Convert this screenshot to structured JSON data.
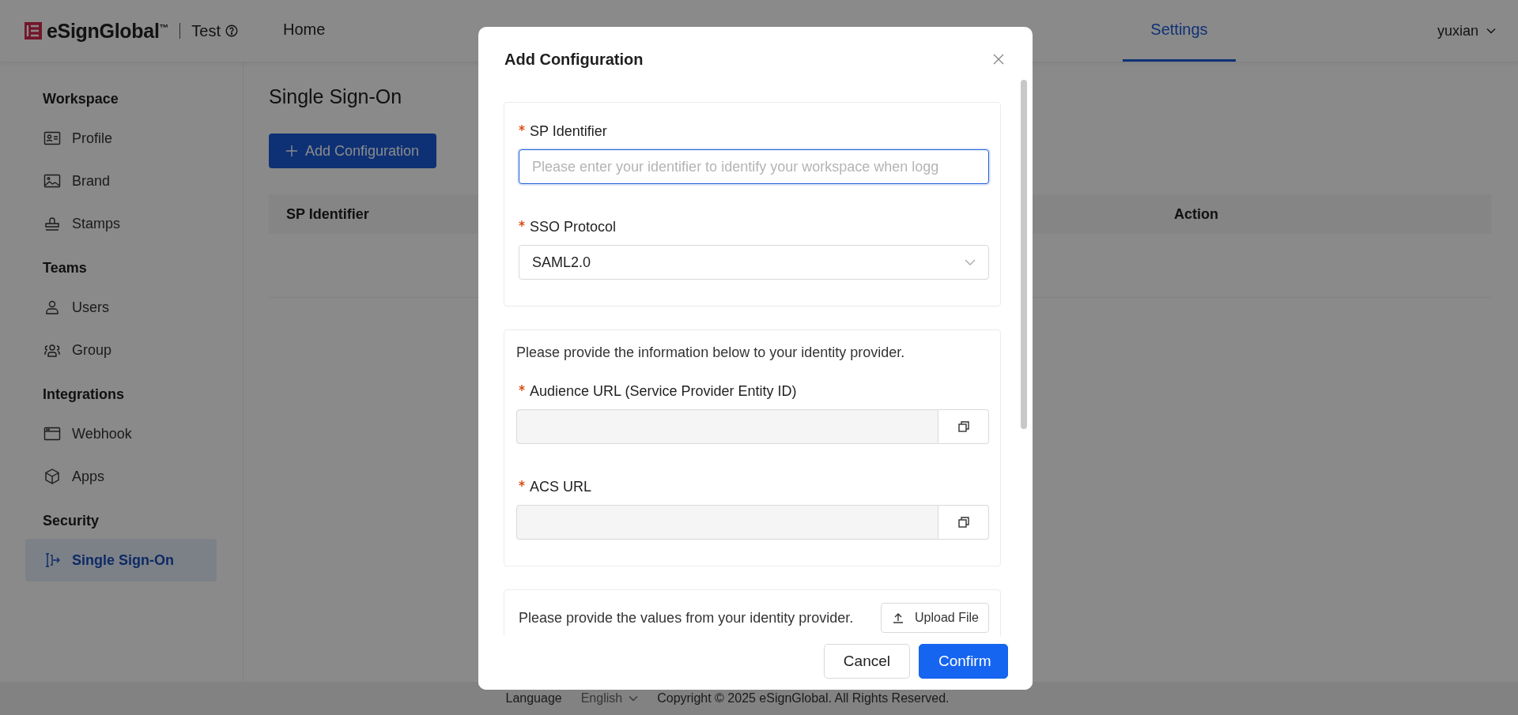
{
  "header": {
    "brand": "eSignGlobal$^{™}$",
    "workspace": "Test",
    "nav": [
      {
        "label": "Home",
        "selected": false
      },
      {
        "label": "Settings",
        "selected": true
      }
    ],
    "user": "yuxian"
  },
  "sidebar": {
    "sections": [
      {
        "title": "Workspace",
        "items": [
          {
            "label": "Profile",
            "selected": false
          },
          {
            "label": "Brand",
            "selected": false
          },
          {
            "label": "Stamps",
            "selected": false
          }
        ]
      },
      {
        "title": "Teams",
        "items": [
          {
            "label": "Users",
            "selected": false
          },
          {
            "label": "Group",
            "selected": false
          }
        ]
      },
      {
        "title": "Integrations",
        "items": [
          {
            "label": "Webhook",
            "selected": false
          },
          {
            "label": "Apps",
            "selected": false
          }
        ]
      },
      {
        "title": "Security",
        "items": [
          {
            "label": "Single Sign-On",
            "selected": true
          }
        ]
      }
    ]
  },
  "main": {
    "title": "Single Sign-On",
    "add_button": "Add Configuration",
    "table": {
      "columns": [
        "SP Identifier",
        "Action"
      ]
    }
  },
  "modal": {
    "title": "Add Configuration",
    "sections": [
      {
        "kind": "form",
        "fields": [
          {
            "kind": "input",
            "label": "SP Identifier",
            "required": true,
            "placeholder": "Please enter your identifier to identify your workspace when logg"
          },
          {
            "kind": "select",
            "label": "SSO Protocol",
            "required": true,
            "value": "SAML2.0"
          }
        ]
      },
      {
        "kind": "form",
        "intro": "Please provide the information below to your identity provider.",
        "fields": [
          {
            "kind": "copy",
            "label": "Audience URL (Service Provider Entity ID)",
            "required": true
          },
          {
            "kind": "copy",
            "label": "ACS URL",
            "required": true
          }
        ]
      },
      {
        "kind": "upload",
        "intro": "Please provide the values from your identity provider.",
        "button": "Upload File"
      }
    ],
    "buttons": [
      {
        "label": "Cancel",
        "kind": "default"
      },
      {
        "label": "Confirm",
        "kind": "primary"
      }
    ]
  },
  "footer": {
    "language_label": "Language",
    "language": "English",
    "copyright": "Copyright © 2025 eSignGlobal. All Rights Reserved."
  }
}
